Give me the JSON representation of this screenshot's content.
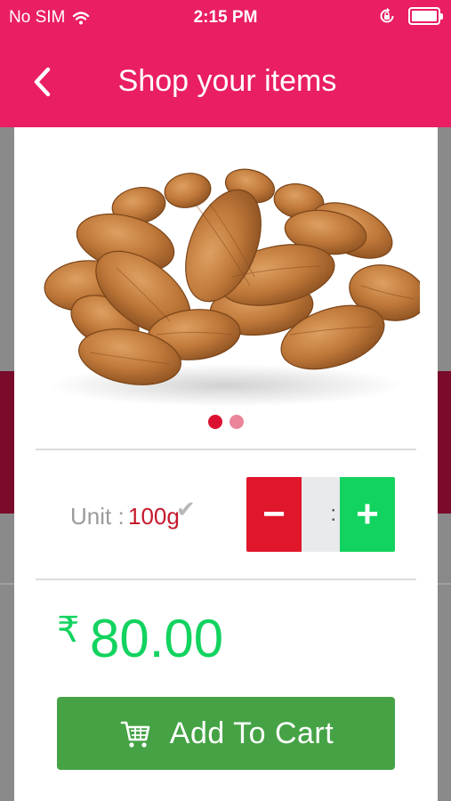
{
  "status_bar": {
    "carrier": "No SIM",
    "time": "2:15 PM",
    "wifi_icon": "wifi-icon",
    "lock_icon": "rotation-lock-icon",
    "battery_icon": "battery-icon"
  },
  "header": {
    "title": "Shop your items",
    "back_icon": "chevron-left-icon"
  },
  "product": {
    "image_alt": "almonds",
    "carousel": {
      "count": 2,
      "active_index": 0
    }
  },
  "unit": {
    "label": "Unit :",
    "value": "100g",
    "check_icon": "check-icon"
  },
  "quantity": {
    "minus_label": "−",
    "value": ":",
    "plus_label": "+"
  },
  "price": {
    "currency": "₹",
    "amount": "80.00"
  },
  "add_to_cart": {
    "label": "Add To Cart",
    "icon": "cart-icon"
  },
  "colors": {
    "header": "#e91e63",
    "price": "#12d35f",
    "cart_button": "#45a345",
    "minus_button": "#e0162b",
    "plus_button": "#12d35f",
    "unit_value": "#c5192d"
  }
}
